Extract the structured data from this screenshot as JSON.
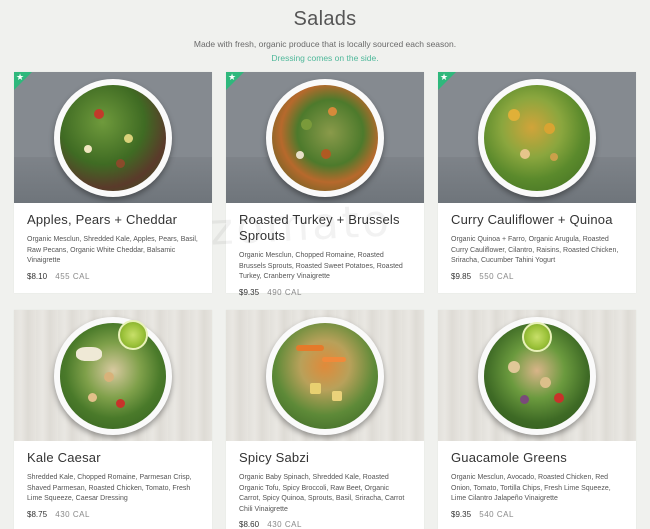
{
  "header": {
    "title": "Salads",
    "subtitle": "Made with fresh, organic produce that is locally sourced each season.",
    "note": "Dressing comes on the side."
  },
  "badge_icon": "star-icon",
  "colors": {
    "accent": "#2fb87c",
    "note": "#4fb89a",
    "background": "#f0f1ee"
  },
  "salads": [
    {
      "name": "Apples, Pears + Cheddar",
      "description": "Organic Mesclun, Shredded Kale, Apples, Pears, Basil, Raw Pecans, Organic White Cheddar, Balsamic Vinaigrette",
      "price": "$8.10",
      "calories": "455 CAL",
      "featured": true
    },
    {
      "name": "Roasted Turkey + Brussels Sprouts",
      "description": "Organic Mesclun, Chopped Romaine, Roasted Brussels Sprouts, Roasted Sweet Potatoes, Roasted Turkey, Cranberry Vinaigrette",
      "price": "$9.35",
      "calories": "490 CAL",
      "featured": true
    },
    {
      "name": "Curry Cauliflower + Quinoa",
      "description": "Organic Quinoa + Farro, Organic Arugula, Roasted Curry Cauliflower, Cilantro, Raisins, Roasted Chicken, Sriracha, Cucumber Tahini Yogurt",
      "price": "$9.85",
      "calories": "550 CAL",
      "featured": true
    },
    {
      "name": "Kale Caesar",
      "description": "Shredded Kale, Chopped Romaine, Parmesan Crisp, Shaved Parmesan, Roasted Chicken, Tomato, Fresh Lime Squeeze, Caesar Dressing",
      "price": "$8.75",
      "calories": "430 CAL",
      "featured": false
    },
    {
      "name": "Spicy Sabzi",
      "description": "Organic Baby Spinach, Shredded Kale, Roasted Organic Tofu, Spicy Broccoli, Raw Beet, Organic Carrot, Spicy Quinoa, Sprouts, Basil, Sriracha, Carrot Chili Vinaigrette",
      "price": "$8.60",
      "calories": "430 CAL",
      "featured": false
    },
    {
      "name": "Guacamole Greens",
      "description": "Organic Mesclun, Avocado, Roasted Chicken, Red Onion, Tomato, Tortilla Chips, Fresh Lime Squeeze, Lime Cilantro Jalapeño Vinaigrette",
      "price": "$9.35",
      "calories": "540 CAL",
      "featured": false
    }
  ],
  "watermark": "zomato"
}
